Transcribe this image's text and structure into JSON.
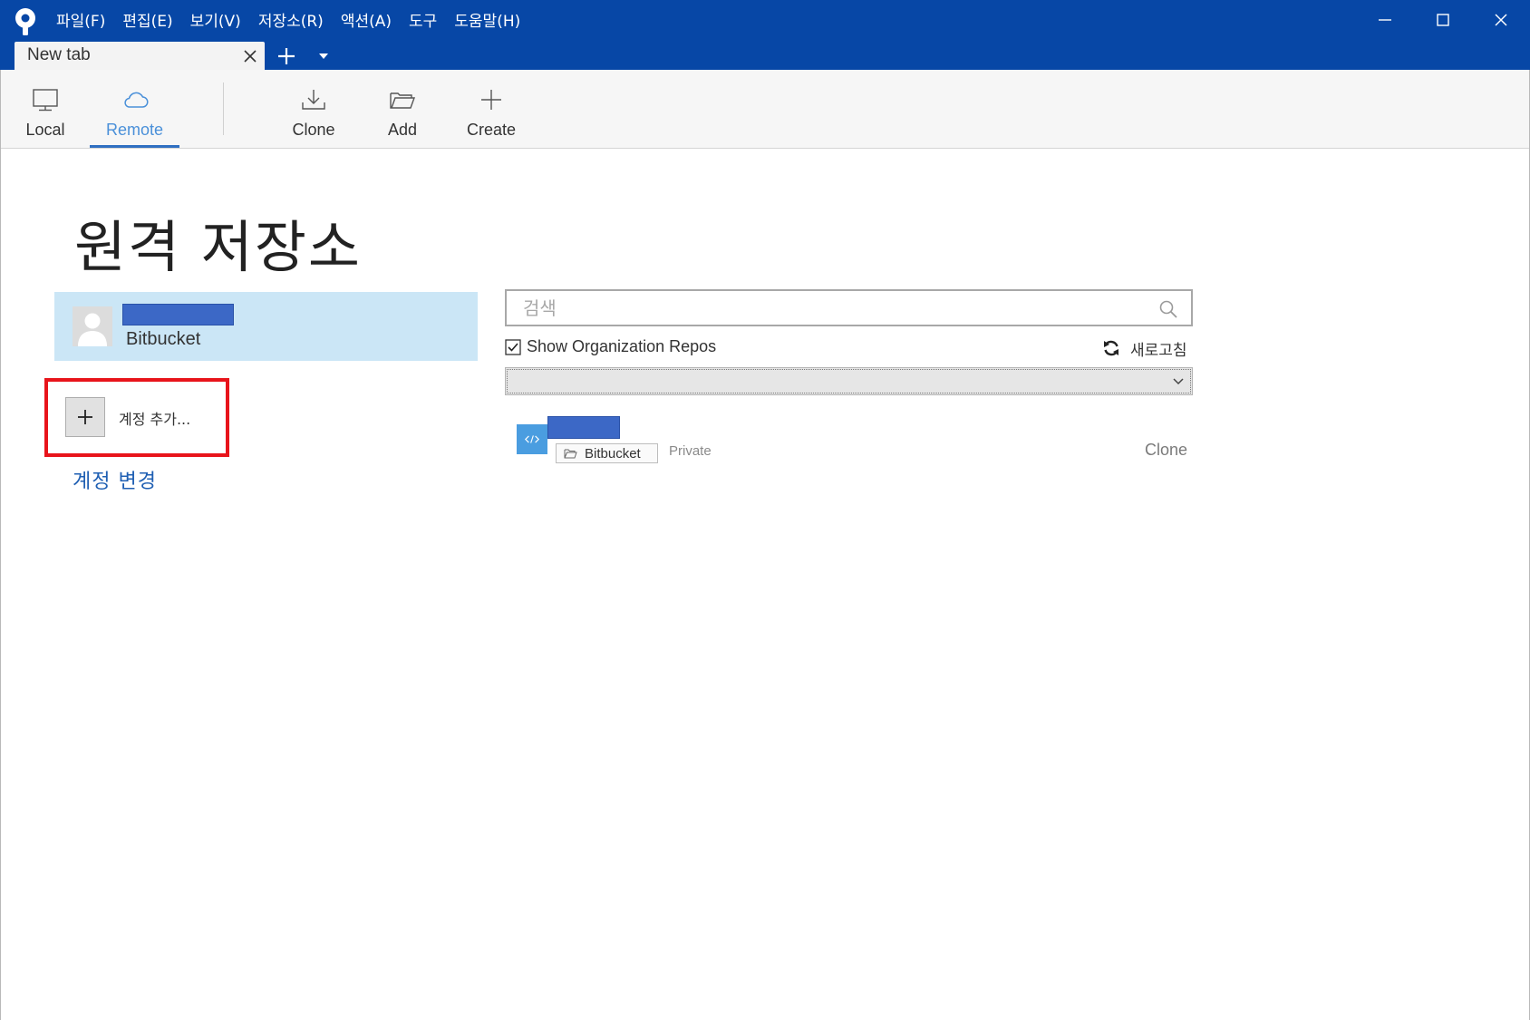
{
  "menu": {
    "items": [
      "파일(F)",
      "편집(E)",
      "보기(V)",
      "저장소(R)",
      "액션(A)",
      "도구",
      "도움말(H)"
    ]
  },
  "tabs": {
    "current": "New tab"
  },
  "toolbar": {
    "local_label": "Local",
    "remote_label": "Remote",
    "clone_label": "Clone",
    "add_label": "Add",
    "create_label": "Create",
    "active": "Remote"
  },
  "page": {
    "title": "원격 저장소"
  },
  "account": {
    "service": "Bitbucket",
    "add_label": "계정 추가...",
    "change_link": "계정 변경"
  },
  "search": {
    "placeholder": "검색",
    "value": ""
  },
  "filters": {
    "show_org_repos_label": "Show Organization Repos",
    "show_org_repos_checked": true,
    "refresh_label": "새로고침",
    "selected": ""
  },
  "repos": [
    {
      "source": "Bitbucket",
      "visibility": "Private",
      "action": "Clone"
    }
  ],
  "colors": {
    "titlebar": "#0747a6",
    "accent": "#2f6fc1",
    "account_card": "#cbe6f6",
    "highlight": "#e8141b",
    "redaction": "#3c68c6"
  }
}
